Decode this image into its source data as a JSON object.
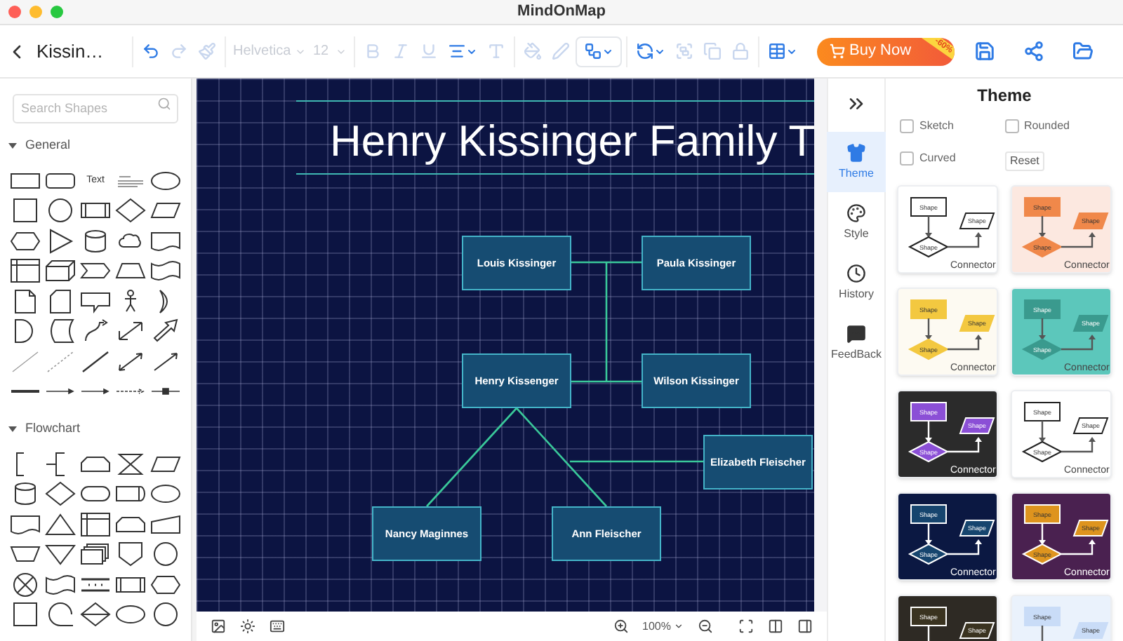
{
  "window": {
    "title": "MindOnMap"
  },
  "toolbar": {
    "document_title": "Kissin…",
    "groups": [
      [
        {
          "kind": "undo",
          "disabled": false
        },
        {
          "kind": "redo",
          "disabled": true
        },
        {
          "kind": "format-painter",
          "disabled": true
        }
      ],
      [
        {
          "kind": "font",
          "value": "Helvetica",
          "disabled": true
        },
        {
          "kind": "size",
          "value": "12",
          "disabled": true
        }
      ],
      [
        {
          "kind": "bold",
          "disabled": true
        },
        {
          "kind": "italic",
          "disabled": true
        },
        {
          "kind": "underline",
          "disabled": true
        },
        {
          "kind": "align",
          "disabled": false
        },
        {
          "kind": "font-color",
          "disabled": true
        }
      ],
      [
        {
          "kind": "fill",
          "disabled": true
        },
        {
          "kind": "line-color",
          "disabled": true
        },
        {
          "kind": "connector",
          "disabled": false
        }
      ],
      [
        {
          "kind": "arrange",
          "disabled": false
        },
        {
          "kind": "group",
          "disabled": true
        },
        {
          "kind": "copy",
          "disabled": true
        },
        {
          "kind": "lock",
          "disabled": true
        }
      ],
      [
        {
          "kind": "table",
          "disabled": false
        }
      ]
    ],
    "buy_button": {
      "label": "Buy Now",
      "badge": "-60%"
    },
    "actions": [
      {
        "kind": "save"
      },
      {
        "kind": "share"
      },
      {
        "kind": "folder"
      }
    ]
  },
  "shapes_panel": {
    "search": {
      "placeholder": "Search Shapes"
    },
    "sections": [
      {
        "title": "General",
        "expanded": true,
        "shapes": [
          {
            "kind": "rectangle"
          },
          {
            "kind": "rounded-rectangle"
          },
          {
            "kind": "text",
            "label": "Text"
          },
          {
            "kind": "text-block"
          },
          {
            "kind": "ellipse"
          },
          {
            "kind": "square"
          },
          {
            "kind": "circle"
          },
          {
            "kind": "process"
          },
          {
            "kind": "diamond"
          },
          {
            "kind": "parallelogram"
          },
          {
            "kind": "hexagon"
          },
          {
            "kind": "triangle"
          },
          {
            "kind": "cylinder"
          },
          {
            "kind": "cloud"
          },
          {
            "kind": "document"
          },
          {
            "kind": "internal-storage"
          },
          {
            "kind": "cube"
          },
          {
            "kind": "step"
          },
          {
            "kind": "trapezoid"
          },
          {
            "kind": "tape"
          },
          {
            "kind": "note"
          },
          {
            "kind": "card"
          },
          {
            "kind": "callout"
          },
          {
            "kind": "stick-figure"
          },
          {
            "kind": "crescent"
          },
          {
            "kind": "half-circle"
          },
          {
            "kind": "stored-data"
          },
          {
            "kind": "curved-arrow"
          },
          {
            "kind": "double-arrow"
          },
          {
            "kind": "thick-arrow"
          },
          {
            "kind": "thin-line"
          },
          {
            "kind": "dashed-line"
          },
          {
            "kind": "line"
          },
          {
            "kind": "double-arrow-line"
          },
          {
            "kind": "arrow-line"
          },
          {
            "kind": "thick-connector"
          },
          {
            "kind": "arrow-connector"
          },
          {
            "kind": "arrow-connector"
          },
          {
            "kind": "dashed-arrow-connector"
          },
          {
            "kind": "link-connector"
          }
        ]
      },
      {
        "title": "Flowchart",
        "expanded": true,
        "shapes": [
          {
            "kind": "bracket"
          },
          {
            "kind": "annotation"
          },
          {
            "kind": "loop-limit"
          },
          {
            "kind": "hourglass"
          },
          {
            "kind": "parallelogram"
          },
          {
            "kind": "cylinder"
          },
          {
            "kind": "diamond"
          },
          {
            "kind": "terminator"
          },
          {
            "kind": "display"
          },
          {
            "kind": "ellipse"
          },
          {
            "kind": "document"
          },
          {
            "kind": "triangle-up"
          },
          {
            "kind": "internal-storage"
          },
          {
            "kind": "loop-limit"
          },
          {
            "kind": "manual-input"
          },
          {
            "kind": "trapezoid-down"
          },
          {
            "kind": "triangle-down"
          },
          {
            "kind": "multi-document"
          },
          {
            "kind": "shield"
          },
          {
            "kind": "circle"
          },
          {
            "kind": "circle-cross"
          },
          {
            "kind": "tape"
          },
          {
            "kind": "dots-bar"
          },
          {
            "kind": "process"
          },
          {
            "kind": "hexagon"
          },
          {
            "kind": "square"
          },
          {
            "kind": "sequential-circle"
          },
          {
            "kind": "sort-diamond"
          },
          {
            "kind": "ellipse"
          },
          {
            "kind": "circle"
          }
        ]
      }
    ]
  },
  "diagram": {
    "title": "Henry Kissinger Family T",
    "nodes": [
      {
        "label": "Louis Kissinger"
      },
      {
        "label": "Paula Kissinger"
      },
      {
        "label": "Henry Kissenger"
      },
      {
        "label": "Wilson Kissinger"
      },
      {
        "label": "Elizabeth Fleischer"
      },
      {
        "label": "Nancy Maginnes"
      },
      {
        "label": "Ann Fleischer"
      }
    ]
  },
  "bottom_bar": {
    "zoom": "100%"
  },
  "side_tabs": [
    {
      "kind": "theme",
      "label": "Theme",
      "selected": true
    },
    {
      "kind": "style",
      "label": "Style",
      "selected": false
    },
    {
      "kind": "history",
      "label": "History",
      "selected": false
    },
    {
      "kind": "feedback",
      "label": "FeedBack",
      "selected": false
    }
  ],
  "theme_panel": {
    "title": "Theme",
    "options": [
      {
        "label": "Sketch",
        "checked": false
      },
      {
        "label": "Rounded",
        "checked": false
      },
      {
        "label": "Curved",
        "checked": false
      }
    ],
    "reset_button": "Reset",
    "cards": [
      {
        "color": "#ffffff",
        "shape": {
          "color": "#ffffff"
        },
        "shape_labels": [
          "Shape",
          "Shape",
          "Shape"
        ],
        "connector": "Connector"
      },
      {
        "color": "#fce8e0",
        "shape": {
          "color": "#f0884a"
        },
        "shape_labels": [
          "Shape",
          "Shape",
          "Shape"
        ],
        "connector": "Connector"
      },
      {
        "color": "#fdfaf2",
        "shape": {
          "color": "#f3c840"
        },
        "shape_labels": [
          "Shape",
          "Shape",
          "Shape"
        ],
        "connector": "Connector"
      },
      {
        "color": "#5cc7bb",
        "shape": {
          "color": "#3a9a8e"
        },
        "shape_labels": [
          "Shape",
          "Shape",
          "Shape"
        ],
        "connector": "Connector"
      },
      {
        "color": "#2b2b2b",
        "shape": {
          "color": "#8b4fd6"
        },
        "shape_labels": [
          "Shape",
          "Shape",
          "Shape"
        ],
        "connector": "Connector"
      },
      {
        "color": "#ffffff",
        "shape": {
          "color": "#ffffff"
        },
        "shape_labels": [
          "Shape",
          "Shape",
          "Shape"
        ],
        "connector": "Connector"
      },
      {
        "color": "#0b1842",
        "shape": {
          "color": "#16456e"
        },
        "shape_labels": [
          "Shape",
          "Shape",
          "Shape"
        ],
        "connector": "Connector"
      },
      {
        "color": "#4a2150",
        "shape": {
          "color": "#de941e"
        },
        "shape_labels": [
          "Shape",
          "Shape",
          "Shape"
        ],
        "connector": "Connector"
      },
      {
        "color": "#2e2a24",
        "shape": {
          "color": "#3a3320"
        },
        "shape_labels": [
          "Shape",
          "Shape"
        ]
      },
      {
        "color": "#eaf2fc",
        "shape": {
          "color": "#c9dcf7"
        },
        "shape_labels": [
          "Shape",
          "Shape"
        ]
      }
    ]
  }
}
